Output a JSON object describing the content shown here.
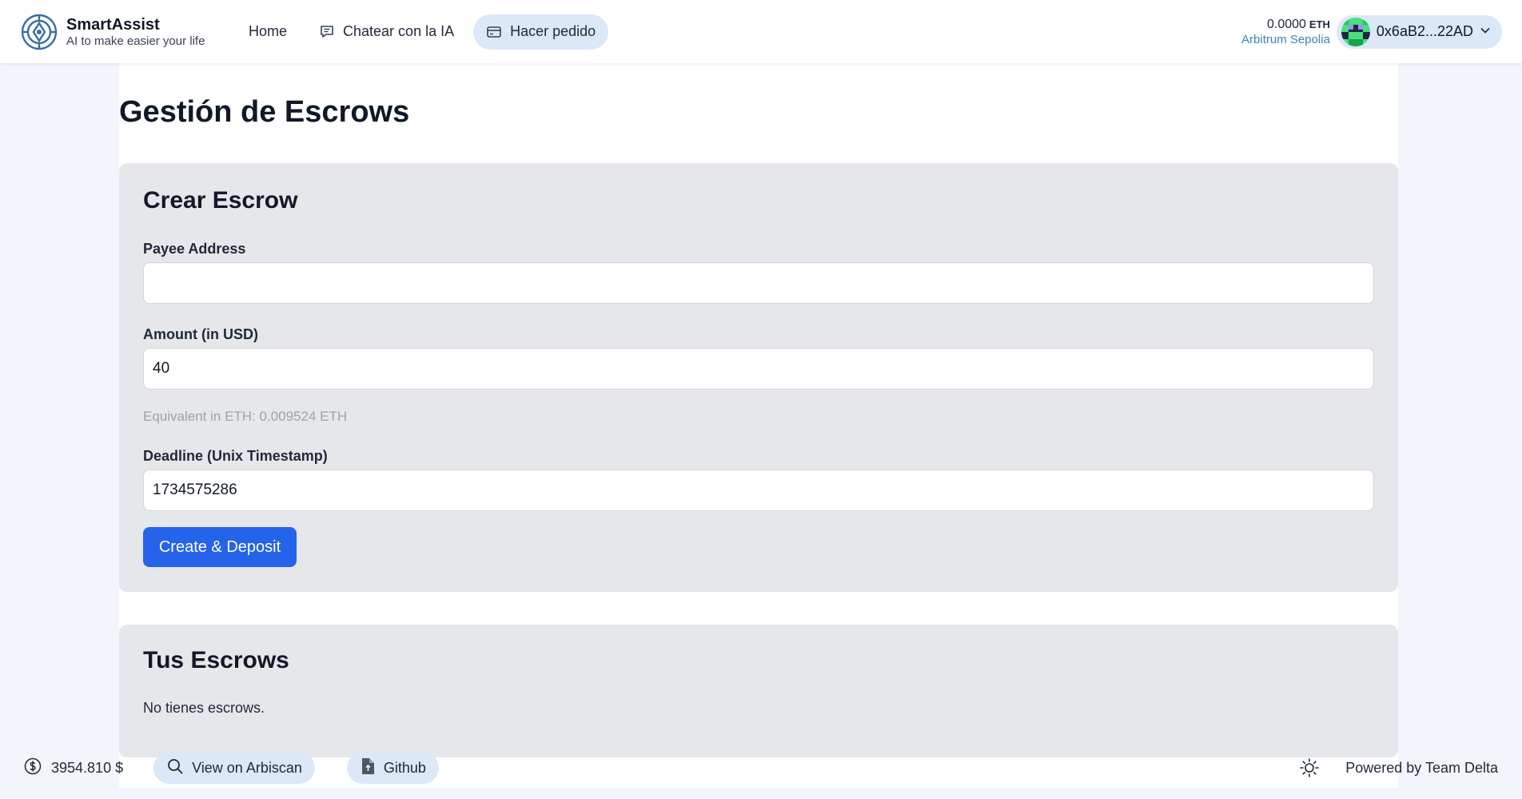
{
  "brand": {
    "name": "SmartAssist",
    "tagline": "AI to make easier your life",
    "logo_icon": "smartassist-logo-icon"
  },
  "nav": {
    "home": "Home",
    "chat": "Chatear con la IA",
    "order": "Hacer pedido"
  },
  "wallet": {
    "balance": "0.0000",
    "unit": "ETH",
    "network": "Arbitrum Sepolia",
    "account": "0x6aB2...22AD"
  },
  "page": {
    "title": "Gestión de Escrows"
  },
  "create": {
    "title": "Crear Escrow",
    "payee_label": "Payee Address",
    "payee_value": "",
    "amount_label": "Amount (in USD)",
    "amount_value": "40",
    "eth_hint": "Equivalent in ETH: 0.009524 ETH",
    "deadline_label": "Deadline (Unix Timestamp)",
    "deadline_value": "1734575286",
    "submit": "Create & Deposit"
  },
  "list": {
    "title": "Tus Escrows",
    "empty": "No tienes escrows."
  },
  "footer": {
    "price": "3954.810 $",
    "arbiscan": "View on Arbiscan",
    "github": "Github",
    "powered": "Powered by Team Delta"
  },
  "colors": {
    "accent": "#2563eb",
    "pill": "#dce7f7",
    "card": "#e5e7eb",
    "network": "#3b82c4",
    "page_bg": "#f2f6fc"
  }
}
